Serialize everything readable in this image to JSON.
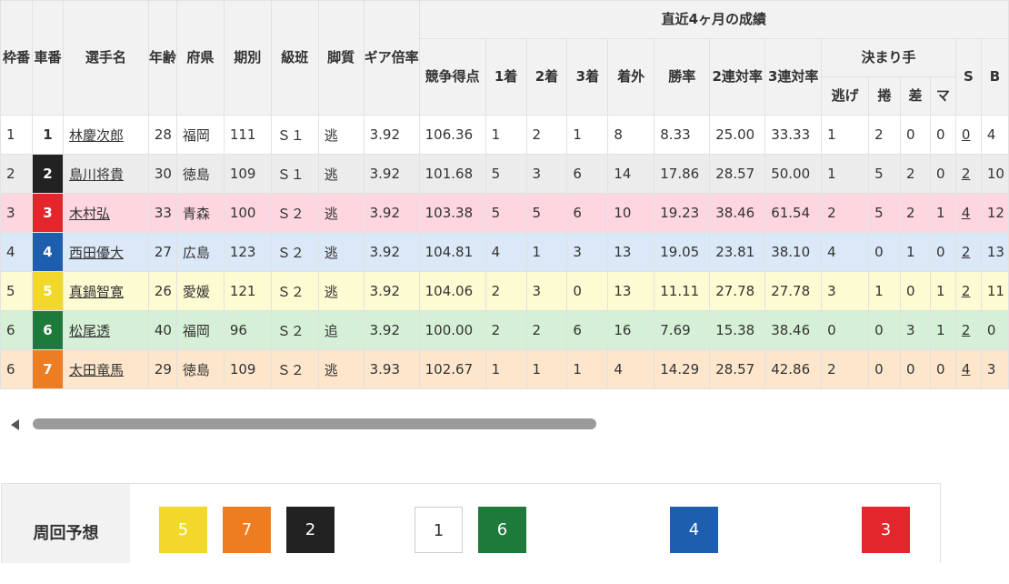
{
  "table": {
    "headers": {
      "waku": "枠番",
      "car": "車番",
      "name": "選手名",
      "age": "年齢",
      "pref": "府県",
      "term": "期別",
      "class": "級班",
      "style": "脚質",
      "gear": "ギア倍率",
      "recent_group": "直近4ヶ月の成績",
      "score": "競争得点",
      "first": "1着",
      "second": "2着",
      "third": "3着",
      "outside": "着外",
      "win_rate": "勝率",
      "quinella_rate": "2連対率",
      "trio_rate": "3連対率",
      "kimarite": "決まり手",
      "nige": "逃げ",
      "makuri": "捲",
      "sashi": "差",
      "mark": "マ",
      "s": "S",
      "b": "B"
    },
    "rows": [
      {
        "waku": "1",
        "car": "1",
        "name": "林慶次郎",
        "age": "28",
        "pref": "福岡",
        "term": "111",
        "class": "Ｓ１",
        "style": "逃",
        "gear": "3.92",
        "score": "106.36",
        "first": "1",
        "second": "2",
        "third": "1",
        "outside": "8",
        "win_rate": "8.33",
        "quinella": "25.00",
        "trio": "33.33",
        "nige": "1",
        "makuri": "2",
        "sashi": "0",
        "mark": "0",
        "s": "0",
        "b": "4"
      },
      {
        "waku": "2",
        "car": "2",
        "name": "島川将貴",
        "age": "30",
        "pref": "徳島",
        "term": "109",
        "class": "Ｓ１",
        "style": "逃",
        "gear": "3.92",
        "score": "101.68",
        "first": "5",
        "second": "3",
        "third": "6",
        "outside": "14",
        "win_rate": "17.86",
        "quinella": "28.57",
        "trio": "50.00",
        "nige": "1",
        "makuri": "5",
        "sashi": "2",
        "mark": "0",
        "s": "2",
        "b": "10"
      },
      {
        "waku": "3",
        "car": "3",
        "name": "木村弘",
        "age": "33",
        "pref": "青森",
        "term": "100",
        "class": "Ｓ２",
        "style": "逃",
        "gear": "3.92",
        "score": "103.38",
        "first": "5",
        "second": "5",
        "third": "6",
        "outside": "10",
        "win_rate": "19.23",
        "quinella": "38.46",
        "trio": "61.54",
        "nige": "2",
        "makuri": "5",
        "sashi": "2",
        "mark": "1",
        "s": "4",
        "b": "12"
      },
      {
        "waku": "4",
        "car": "4",
        "name": "西田優大",
        "age": "27",
        "pref": "広島",
        "term": "123",
        "class": "Ｓ２",
        "style": "逃",
        "gear": "3.92",
        "score": "104.81",
        "first": "4",
        "second": "1",
        "third": "3",
        "outside": "13",
        "win_rate": "19.05",
        "quinella": "23.81",
        "trio": "38.10",
        "nige": "4",
        "makuri": "0",
        "sashi": "1",
        "mark": "0",
        "s": "2",
        "b": "13"
      },
      {
        "waku": "5",
        "car": "5",
        "name": "真鍋智寛",
        "age": "26",
        "pref": "愛媛",
        "term": "121",
        "class": "Ｓ２",
        "style": "逃",
        "gear": "3.92",
        "score": "104.06",
        "first": "2",
        "second": "3",
        "third": "0",
        "outside": "13",
        "win_rate": "11.11",
        "quinella": "27.78",
        "trio": "27.78",
        "nige": "3",
        "makuri": "1",
        "sashi": "0",
        "mark": "1",
        "s": "2",
        "b": "11"
      },
      {
        "waku": "6",
        "car": "6",
        "name": "松尾透",
        "age": "40",
        "pref": "福岡",
        "term": "96",
        "class": "Ｓ２",
        "style": "追",
        "gear": "3.92",
        "score": "100.00",
        "first": "2",
        "second": "2",
        "third": "6",
        "outside": "16",
        "win_rate": "7.69",
        "quinella": "15.38",
        "trio": "38.46",
        "nige": "0",
        "makuri": "0",
        "sashi": "3",
        "mark": "1",
        "s": "2",
        "b": "0"
      },
      {
        "waku": "6",
        "car": "7",
        "name": "太田竜馬",
        "age": "29",
        "pref": "徳島",
        "term": "109",
        "class": "Ｓ２",
        "style": "逃",
        "gear": "3.93",
        "score": "102.67",
        "first": "1",
        "second": "1",
        "third": "1",
        "outside": "4",
        "win_rate": "14.29",
        "quinella": "28.57",
        "trio": "42.86",
        "nige": "2",
        "makuri": "0",
        "sashi": "0",
        "mark": "0",
        "s": "4",
        "b": "3"
      }
    ]
  },
  "row_colors": [
    "#ffffff",
    "#ececec",
    "#fdd6e0",
    "#dbe8f7",
    "#fdfbd2",
    "#d5f0d6",
    "#fde6cc"
  ],
  "car_colors": {
    "1": {
      "bg": "#ffffff",
      "fg": "#333333"
    },
    "2": {
      "bg": "#222222",
      "fg": "#ffffff"
    },
    "3": {
      "bg": "#e3262b",
      "fg": "#ffffff"
    },
    "4": {
      "bg": "#1d5fae",
      "fg": "#ffffff"
    },
    "5": {
      "bg": "#f2d82a",
      "fg": "#ffffff"
    },
    "6": {
      "bg": "#1e7a3a",
      "fg": "#ffffff"
    },
    "7": {
      "bg": "#ee7d22",
      "fg": "#ffffff"
    }
  },
  "prediction": {
    "label": "周回予想",
    "boxes": [
      "5",
      "7",
      "2",
      "1",
      "6",
      "4",
      "3"
    ]
  }
}
